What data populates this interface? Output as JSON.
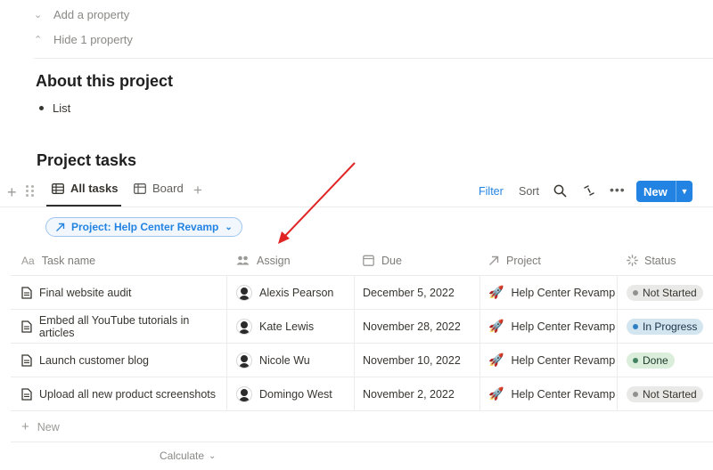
{
  "properties": {
    "add_label": "Add a property",
    "hide_label": "Hide 1 property"
  },
  "about": {
    "heading": "About this project",
    "bullet": "List"
  },
  "tasks_section": {
    "heading": "Project tasks"
  },
  "toolbar": {
    "tabs": [
      {
        "label": "All tasks",
        "icon": "table-icon",
        "active": true
      },
      {
        "label": "Board",
        "icon": "board-icon",
        "active": false
      }
    ],
    "filter_label": "Filter",
    "sort_label": "Sort",
    "new_label": "New"
  },
  "filter_chip": {
    "label": "Project: Help Center Revamp"
  },
  "table": {
    "columns": [
      {
        "label": "Task name",
        "icon": "Aa"
      },
      {
        "label": "Assign",
        "icon": "people-icon"
      },
      {
        "label": "Due",
        "icon": "calendar-icon"
      },
      {
        "label": "Project",
        "icon": "relation-arrow-icon"
      },
      {
        "label": "Status",
        "icon": "status-icon"
      }
    ],
    "rows": [
      {
        "task": "Final website audit",
        "assignee": "Alexis Pearson",
        "due": "December 5, 2022",
        "project": "Help Center Revamp",
        "status": "Not Started"
      },
      {
        "task": "Embed all YouTube tutorials in articles",
        "assignee": "Kate Lewis",
        "due": "November 28, 2022",
        "project": "Help Center Revamp",
        "status": "In Progress"
      },
      {
        "task": "Launch customer blog",
        "assignee": "Nicole Wu",
        "due": "November 10, 2022",
        "project": "Help Center Revamp",
        "status": "Done"
      },
      {
        "task": "Upload all new product screenshots",
        "assignee": "Domingo West",
        "due": "November 2, 2022",
        "project": "Help Center Revamp",
        "status": "Not Started"
      }
    ],
    "new_row_label": "New",
    "calculate_label": "Calculate"
  },
  "status_colors": {
    "Not Started": {
      "bg": "#e9e9e7",
      "dot": "#91918e",
      "text": "#37352f"
    },
    "In Progress": {
      "bg": "#d3e5ef",
      "dot": "#2f80c3",
      "text": "#183347"
    },
    "Done": {
      "bg": "#dbeddb",
      "dot": "#448361",
      "text": "#1c3829"
    }
  },
  "colors": {
    "accent": "#2383e2",
    "annotation_arrow": "#e02424"
  }
}
